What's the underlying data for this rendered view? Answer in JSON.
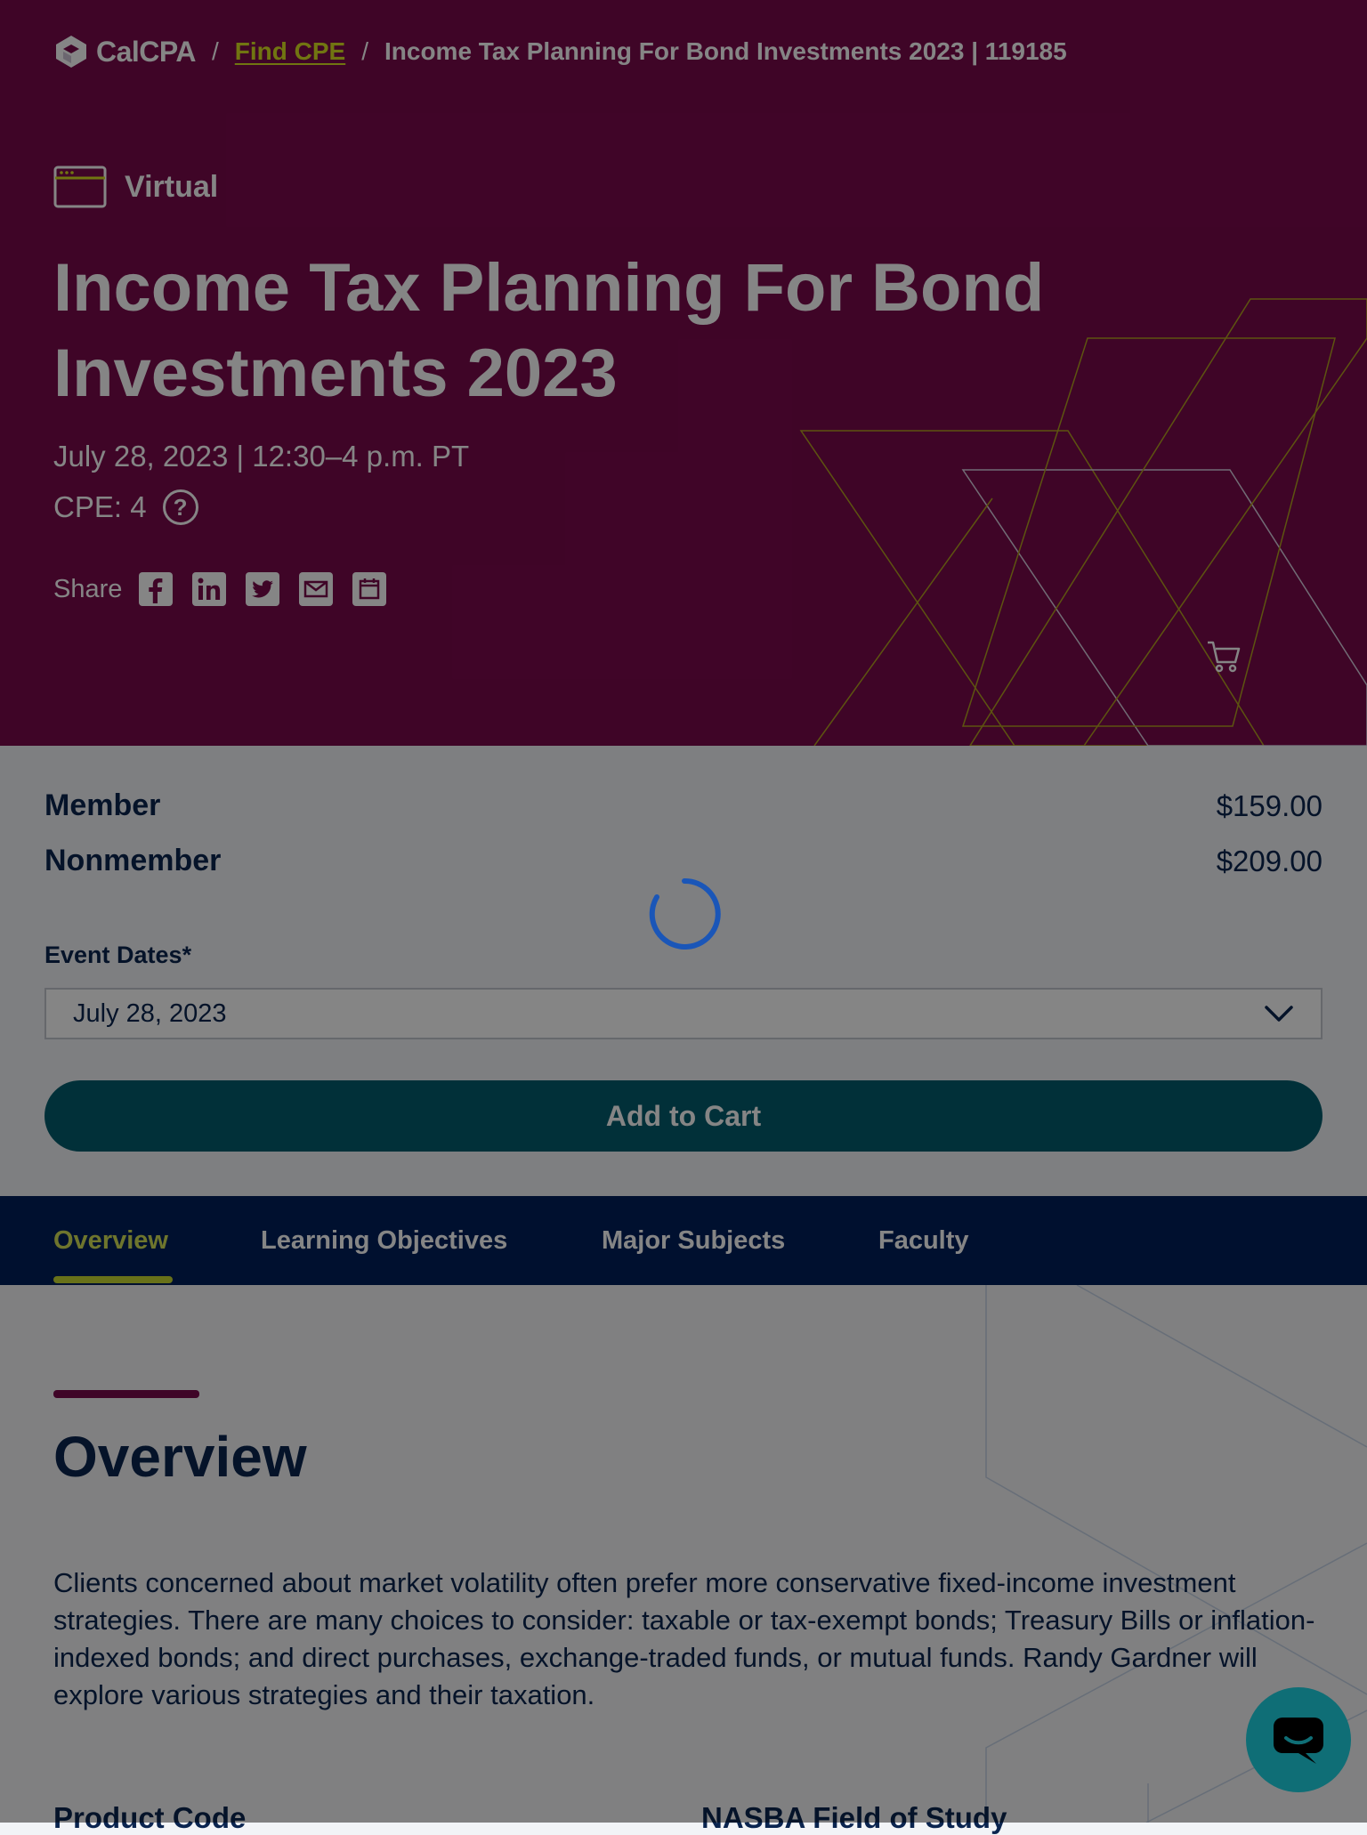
{
  "breadcrumb": {
    "logo_text": "CalCPA",
    "separator": "/",
    "link": "Find CPE",
    "current": "Income Tax Planning For Bond Investments 2023 | 119185"
  },
  "hero": {
    "format": "Virtual",
    "title": "Income Tax Planning For Bond Investments 2023",
    "date": "July 28, 2023 | 12:30–4 p.m. PT",
    "cpe": "CPE: 4",
    "share_label": "Share",
    "share_icons": [
      "facebook-icon",
      "linkedin-icon",
      "twitter-icon",
      "email-icon",
      "calendar-icon"
    ]
  },
  "pricing": {
    "member_label": "Member",
    "member_price": "$159.00",
    "nonmember_label": "Nonmember",
    "nonmember_price": "$209.00"
  },
  "event_dates": {
    "label": "Event Dates*",
    "selected": "July 28, 2023"
  },
  "add_to_cart": "Add to Cart",
  "tabs": [
    {
      "label": "Overview",
      "active": true
    },
    {
      "label": "Learning Objectives",
      "active": false
    },
    {
      "label": "Major Subjects",
      "active": false
    },
    {
      "label": "Faculty",
      "active": false
    }
  ],
  "overview": {
    "heading": "Overview",
    "text": "Clients concerned about market volatility often prefer more conservative fixed-income investment strategies. There are many choices to consider: taxable or tax-exempt bonds; Treasury Bills or inflation-indexed bonds; and direct purchases, exchange-traded funds, or mutual funds. Randy Gardner will explore various strategies and their taxation.",
    "product_code_label": "Product Code",
    "nasba_label": "NASBA Field of Study"
  },
  "colors": {
    "hero_bg": "#7a0a4c",
    "accent_lime": "#d9e021",
    "navy": "#0b2550",
    "teal_button": "#035d6d",
    "tabs_bg": "#00205b"
  }
}
